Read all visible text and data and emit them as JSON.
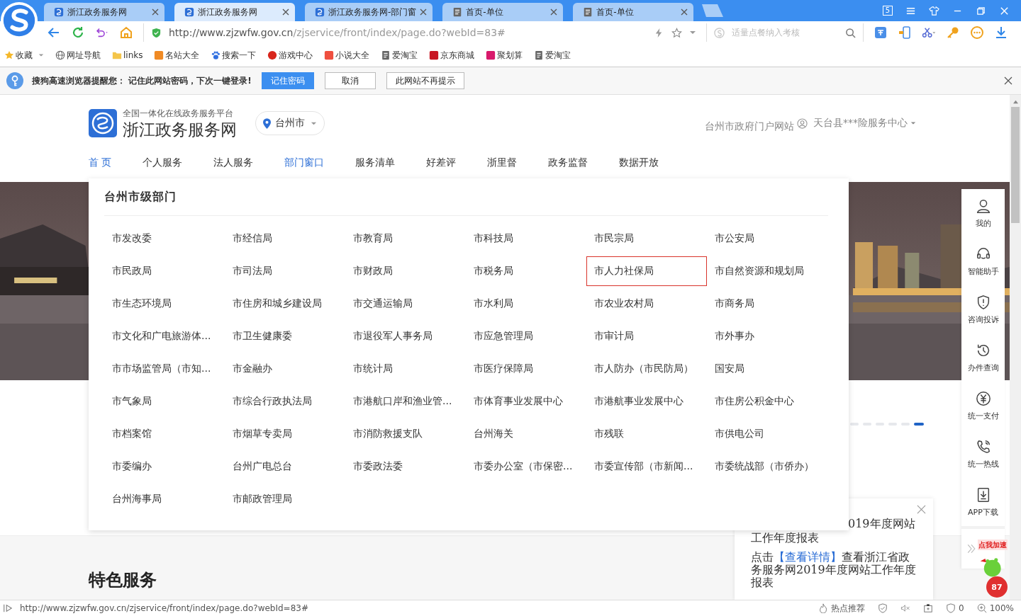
{
  "browser": {
    "tabs": [
      {
        "title": "浙江政务服务网",
        "kind": "site",
        "selected": false
      },
      {
        "title": "浙江政务服务网",
        "kind": "site",
        "selected": true
      },
      {
        "title": "浙江政务服务网-部门窗",
        "kind": "site",
        "selected": false
      },
      {
        "title": "首页-单位",
        "kind": "page",
        "selected": false
      },
      {
        "title": "首页-单位",
        "kind": "page",
        "selected": false
      }
    ],
    "window_badge": "5",
    "address": {
      "host": "http://www.zjzwfw.gov.cn",
      "path": "/zjservice/front/index/page.do?webId=83#"
    },
    "search_placeholder": "适量点餐纳入考核",
    "bookmarks": [
      {
        "label": "收藏",
        "kind": "star"
      },
      {
        "label": "网址导航",
        "kind": "globe"
      },
      {
        "label": "links",
        "kind": "folder"
      },
      {
        "label": "名站大全",
        "kind": "tile",
        "color": "#f08a24"
      },
      {
        "label": "搜索一下",
        "kind": "paw"
      },
      {
        "label": "游戏中心",
        "kind": "round",
        "color": "#d8261c"
      },
      {
        "label": "小说大全",
        "kind": "tile",
        "color": "#ef4f3f"
      },
      {
        "label": "爱淘宝",
        "kind": "doc"
      },
      {
        "label": "京东商城",
        "kind": "tile",
        "color": "#c81623"
      },
      {
        "label": "聚划算",
        "kind": "tile",
        "color": "#d8196b"
      },
      {
        "label": "爱淘宝",
        "kind": "doc"
      }
    ],
    "prompt": {
      "message": "搜狗高速浏览器提醒您： 记住此网站密码，下次一键登录!",
      "buttons": [
        {
          "label": "记住密码",
          "primary": true
        },
        {
          "label": "取消",
          "primary": false
        },
        {
          "label": "此网站不再提示",
          "primary": false
        }
      ]
    }
  },
  "site": {
    "tagline": "全国一体化在线政务服务平台",
    "name": "浙江政务服务网",
    "city": "台州市",
    "portal_link": "台州市政府门户网站",
    "user": "天台县***险服务中心",
    "nav": [
      {
        "label": "首 页",
        "selected": true
      },
      {
        "label": "个人服务",
        "selected": false
      },
      {
        "label": "法人服务",
        "selected": false
      },
      {
        "label": "部门窗口",
        "selected": true
      },
      {
        "label": "服务清单",
        "selected": false
      },
      {
        "label": "好差评",
        "selected": false
      },
      {
        "label": "浙里督",
        "selected": false
      },
      {
        "label": "政务监督",
        "selected": false
      },
      {
        "label": "数据开放",
        "selected": false
      }
    ],
    "dept_panel": {
      "title": "台州市级部门",
      "items": [
        {
          "name": "市发改委",
          "selected": false
        },
        {
          "name": "市经信局",
          "selected": false
        },
        {
          "name": "市教育局",
          "selected": false
        },
        {
          "name": "市科技局",
          "selected": false
        },
        {
          "name": "市民宗局",
          "selected": false
        },
        {
          "name": "市公安局",
          "selected": false
        },
        {
          "name": "市民政局",
          "selected": false
        },
        {
          "name": "市司法局",
          "selected": false
        },
        {
          "name": "市财政局",
          "selected": false
        },
        {
          "name": "市税务局",
          "selected": false
        },
        {
          "name": "市人力社保局",
          "selected": true
        },
        {
          "name": "市自然资源和规划局",
          "selected": false
        },
        {
          "name": "市生态环境局",
          "selected": false
        },
        {
          "name": "市住房和城乡建设局",
          "selected": false
        },
        {
          "name": "市交通运输局",
          "selected": false
        },
        {
          "name": "市水利局",
          "selected": false
        },
        {
          "name": "市农业农村局",
          "selected": false
        },
        {
          "name": "市商务局",
          "selected": false
        },
        {
          "name": "市文化和广电旅游体...",
          "selected": false
        },
        {
          "name": "市卫生健康委",
          "selected": false
        },
        {
          "name": "市退役军人事务局",
          "selected": false
        },
        {
          "name": "市应急管理局",
          "selected": false
        },
        {
          "name": "市审计局",
          "selected": false
        },
        {
          "name": "市外事办",
          "selected": false
        },
        {
          "name": "市市场监管局（市知...",
          "selected": false
        },
        {
          "name": "市金融办",
          "selected": false
        },
        {
          "name": "市统计局",
          "selected": false
        },
        {
          "name": "市医疗保障局",
          "selected": false
        },
        {
          "name": "市人防办（市民防局）",
          "selected": false
        },
        {
          "name": "国安局",
          "selected": false
        },
        {
          "name": "市气象局",
          "selected": false
        },
        {
          "name": "市综合行政执法局",
          "selected": false
        },
        {
          "name": "市港航口岸和渔业管...",
          "selected": false
        },
        {
          "name": "市体育事业发展中心",
          "selected": false
        },
        {
          "name": "市港航事业发展中心",
          "selected": false
        },
        {
          "name": "市住房公积金中心",
          "selected": false
        },
        {
          "name": "市档案馆",
          "selected": false
        },
        {
          "name": "市烟草专卖局",
          "selected": false
        },
        {
          "name": "市消防救援支队",
          "selected": false
        },
        {
          "name": "台州海关",
          "selected": false
        },
        {
          "name": "市残联",
          "selected": false
        },
        {
          "name": "市供电公司",
          "selected": false
        },
        {
          "name": "市委编办",
          "selected": false
        },
        {
          "name": "台州广电总台",
          "selected": false
        },
        {
          "name": "市委政法委",
          "selected": false
        },
        {
          "name": "市委办公室（市保密...",
          "selected": false
        },
        {
          "name": "市委宣传部（市新闻...",
          "selected": false
        },
        {
          "name": "市委统战部（市侨办）",
          "selected": false
        },
        {
          "name": "台州海事局",
          "selected": false
        },
        {
          "name": "市邮政管理局",
          "selected": false
        }
      ]
    },
    "carousel_dots": [
      {
        "selected": false
      },
      {
        "selected": false
      },
      {
        "selected": false
      },
      {
        "selected": false
      },
      {
        "selected": false
      },
      {
        "selected": true
      }
    ],
    "sidebar": [
      {
        "label": "我的",
        "kind": "user"
      },
      {
        "label": "智能助手",
        "kind": "headset"
      },
      {
        "label": "咨询投诉",
        "kind": "shield"
      },
      {
        "label": "办件查询",
        "kind": "history"
      },
      {
        "label": "统一支付",
        "kind": "yuan"
      },
      {
        "label": "统一热线",
        "kind": "phone"
      },
      {
        "label": "APP下载",
        "kind": "download"
      }
    ],
    "notice": {
      "title_lines": [
        "019年度网站",
        "工作年度报表"
      ],
      "before": "点击",
      "link": "【查看详情】",
      "after": "查看浙江省政务服务网2019年度网站工作年度报表"
    },
    "section_title": "特色服务",
    "speed_ad": {
      "label": "点我加速",
      "value": "87"
    }
  },
  "status_bar": {
    "url": "http://www.zjzwfw.gov.cn/zjservice/front/index/page.do?webId=83#",
    "hot": "热点推荐",
    "ad_count": "0",
    "zoom": "100%"
  }
}
